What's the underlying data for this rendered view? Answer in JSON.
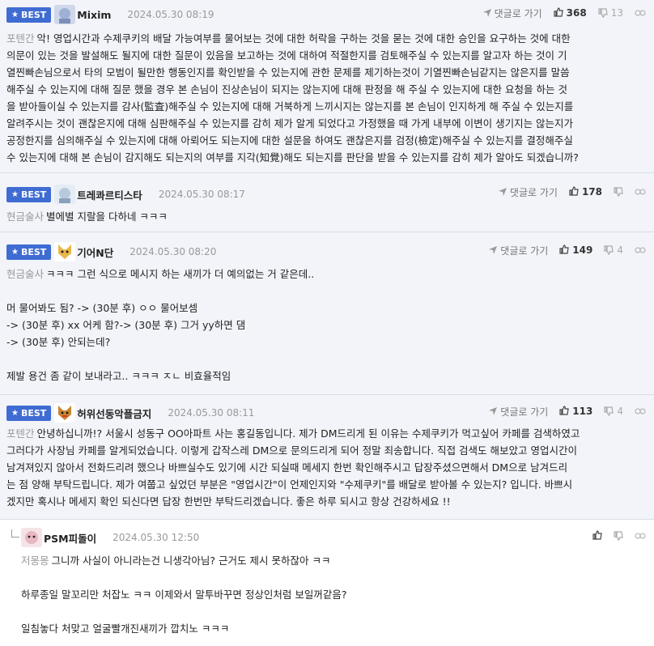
{
  "ui": {
    "best_label": "BEST",
    "reply_label": "댓글로 가기"
  },
  "comments": [
    {
      "nick": "Mixim",
      "date": "2024.05.30 08:19",
      "up": "368",
      "down": "13",
      "tag": "포텐간",
      "lines": [
        "악! 영업시간과 수제쿠키의 배달 가능여부를 물어보는 것에 대한 허락을 구하는 것을 묻는 것에 대한 승인을 요구하는 것에 대한",
        "의문이 있는 것을 발설해도 될지에 대한 질문이 있음을 보고하는 것에 대하여 적절한지를 검토해주실 수 있는지를 알고자 하는 것이 기",
        "열찐빠손님으로서 타의 모범이 될만한 행동인지를 확인받을 수 있는지에 관한 문제를 제기하는것이 기열찐빠손님같지는 않은지를 말씀",
        "해주실 수 있는지에 대해 질문 했을 경우 본 손님이 진상손님이 되지는 않는지에 대해 판정을 해 주실 수 있는지에 대한 요청을 하는 것",
        "을 받아들이실 수 있는지를 감사(監査)해주실 수 있는지에 대해 거북하게 느끼시지는 않는지를 본 손님이 인지하게 해 주실 수 있는지를",
        "알려주시는 것이 괜찮은지에 대해 심판해주실 수 있는지를 감히 제가 알게 되었다고 가정했을 때 가게 내부에 이변이 생기지는 않는지가",
        "공정한지를 심의해주실 수 있는지에 대해 아뢰어도 되는지에 대한 설문을 하여도 괜찮은지를 검정(檢定)해주실 수 있는지를 결정해주실",
        "수 있는지에 대해 본 손님이 감지해도 되는지의 여부를 지각(知覺)해도 되는지를 판단을 받을 수 있는지를 감히 제가 알아도 되겠습니까?"
      ]
    },
    {
      "nick": "트레콰르티스타",
      "date": "2024.05.30 08:17",
      "up": "178",
      "tag": "현금술사",
      "lines": [
        "별에별 지랄을 다하네 ㅋㅋㅋ"
      ]
    },
    {
      "nick": "기어N단",
      "date": "2024.05.30 08:20",
      "up": "149",
      "down": "4",
      "tag": "현금술사",
      "lines": [
        "ㅋㅋㅋ 그런 식으로 메시지 하는 새끼가 더 예의없는 거 같은데..",
        "",
        "머 물어봐도 됨? -> (30분 후) ㅇㅇ 물어보셈",
        "-> (30분 후) xx 어케 함?-> (30분 후) 그거 yy하면 댐",
        "-> (30분 후) 안되는데?",
        "",
        "제발 용건 좀 같이 보내라고.. ㅋㅋㅋ ㅈㄴ 비효율적임"
      ]
    },
    {
      "nick": "허위선동악플금지",
      "date": "2024.05.30 08:11",
      "up": "113",
      "down": "4",
      "tag": "포텐간",
      "lines": [
        "안녕하십니까!? 서울시 성동구 OO아파트 사는 홍길동입니다. 제가 DM드리게 된 이유는 수제쿠키가 먹고싶어 카페를 검색하였고",
        "그러다가 사장님 카페를 알게되었습니다. 이렇게 갑작스레 DM으로 문의드리게 되어 정말 죄송합니다. 직접 검색도 해보았고 영업시간이",
        "남겨져있지 않아서 전화드리려 했으나 바쁘실수도 있기에 시간 되실때 메세지 한번 확인해주시고 답장주셨으면해서 DM으로 남겨드리",
        "는 점 양해 부탁드립니다. 제가 여쭙고 싶었던 부분은 \"영업시간\"이 언제인지와 \"수제쿠키\"를 배달로 받아볼 수 있는지? 입니다. 바쁘시",
        "겠지만 혹시나 메세지 확인 되신다면 답장 한번만 부탁드리겠습니다. 좋은 하루 되시고 항상 건강하세요 !!"
      ]
    },
    {
      "nick": "PSM피돌이",
      "date": "2024.05.30 12:50",
      "tag": "저몽몽",
      "lines": [
        "그니까 사실이 아니라는건 니생각아님? 근거도 제시 못하잖아 ㅋㅋ",
        "",
        "하루종일 말꼬리만 처잡노 ㅋㅋ 이제와서 말투바꾸면 정상인처럼 보일꺼같음?",
        "",
        "일침놓다 처맞고 얼굴빨개진새끼가 깝치노 ㅋㅋㅋ"
      ]
    }
  ]
}
